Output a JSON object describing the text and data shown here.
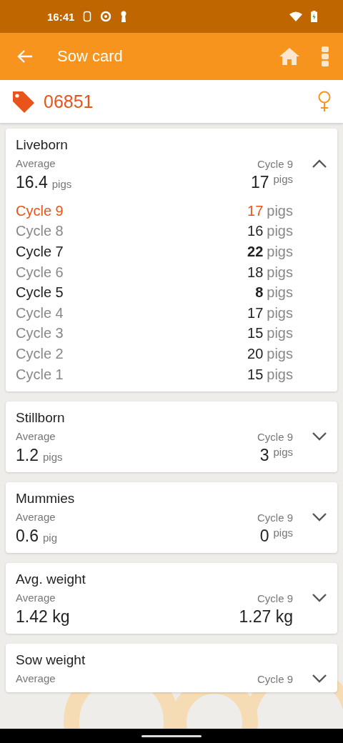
{
  "status_bar": {
    "time": "16:41"
  },
  "app_bar": {
    "title": "Sow card"
  },
  "sow": {
    "tag": "06851"
  },
  "cards": [
    {
      "title": "Liveborn",
      "expanded": true,
      "avg_label": "Average",
      "avg_value": "16.4",
      "avg_unit": "pigs",
      "last_label": "Cycle 9",
      "last_value": "17",
      "last_unit": "pigs",
      "cycles": [
        {
          "label": "Cycle 9",
          "value": "17",
          "unit": "pigs",
          "kind": "current"
        },
        {
          "label": "Cycle 8",
          "value": "16",
          "unit": "pigs",
          "kind": "normal"
        },
        {
          "label": "Cycle 7",
          "value": "22",
          "unit": "pigs",
          "kind": "marked"
        },
        {
          "label": "Cycle 6",
          "value": "18",
          "unit": "pigs",
          "kind": "normal"
        },
        {
          "label": "Cycle 5",
          "value": "8",
          "unit": "pigs",
          "kind": "marked"
        },
        {
          "label": "Cycle 4",
          "value": "17",
          "unit": "pigs",
          "kind": "normal"
        },
        {
          "label": "Cycle 3",
          "value": "15",
          "unit": "pigs",
          "kind": "normal"
        },
        {
          "label": "Cycle 2",
          "value": "20",
          "unit": "pigs",
          "kind": "normal"
        },
        {
          "label": "Cycle 1",
          "value": "15",
          "unit": "pigs",
          "kind": "normal"
        }
      ]
    },
    {
      "title": "Stillborn",
      "expanded": false,
      "avg_label": "Average",
      "avg_value": "1.2",
      "avg_unit": "pigs",
      "last_label": "Cycle 9",
      "last_value": "3",
      "last_unit": "pigs"
    },
    {
      "title": "Mummies",
      "expanded": false,
      "avg_label": "Average",
      "avg_value": "0.6",
      "avg_unit": "pig",
      "last_label": "Cycle 9",
      "last_value": "0",
      "last_unit": "pigs"
    },
    {
      "title": "Avg. weight",
      "expanded": false,
      "avg_label": "Average",
      "avg_value": "1.42 kg",
      "last_label": "Cycle 9",
      "last_value": "1.27 kg"
    },
    {
      "title": "Sow weight",
      "expanded": false,
      "avg_label": "Average",
      "last_label": "Cycle 9"
    }
  ]
}
